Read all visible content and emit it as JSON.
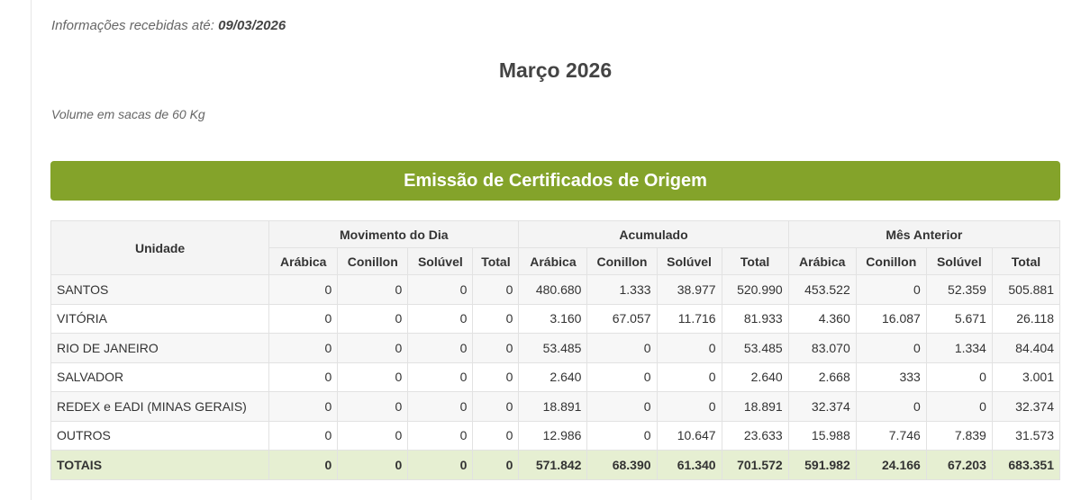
{
  "header": {
    "received_prefix": "Informações recebidas até:",
    "received_date": "09/03/2026",
    "title": "Março 2026",
    "volume_note": "Volume em sacas de 60 Kg"
  },
  "banner": {
    "title": "Emissão de Certificados de Origem",
    "color": "#84a32a"
  },
  "table": {
    "unit_header": "Unidade",
    "groups": [
      "Movimento do Dia",
      "Acumulado",
      "Mês Anterior"
    ],
    "subheaders": [
      "Arábica",
      "Conillon",
      "Solúvel",
      "Total"
    ],
    "rows": [
      {
        "unit": "SANTOS",
        "values": [
          "0",
          "0",
          "0",
          "0",
          "480.680",
          "1.333",
          "38.977",
          "520.990",
          "453.522",
          "0",
          "52.359",
          "505.881"
        ]
      },
      {
        "unit": "VITÓRIA",
        "values": [
          "0",
          "0",
          "0",
          "0",
          "3.160",
          "67.057",
          "11.716",
          "81.933",
          "4.360",
          "16.087",
          "5.671",
          "26.118"
        ]
      },
      {
        "unit": "RIO DE JANEIRO",
        "values": [
          "0",
          "0",
          "0",
          "0",
          "53.485",
          "0",
          "0",
          "53.485",
          "83.070",
          "0",
          "1.334",
          "84.404"
        ]
      },
      {
        "unit": "SALVADOR",
        "values": [
          "0",
          "0",
          "0",
          "0",
          "2.640",
          "0",
          "0",
          "2.640",
          "2.668",
          "333",
          "0",
          "3.001"
        ]
      },
      {
        "unit": "REDEX e EADI (MINAS GERAIS)",
        "values": [
          "0",
          "0",
          "0",
          "0",
          "18.891",
          "0",
          "0",
          "18.891",
          "32.374",
          "0",
          "0",
          "32.374"
        ]
      },
      {
        "unit": "OUTROS",
        "values": [
          "0",
          "0",
          "0",
          "0",
          "12.986",
          "0",
          "10.647",
          "23.633",
          "15.988",
          "7.746",
          "7.839",
          "31.573"
        ]
      }
    ],
    "totals": {
      "unit": "TOTAIS",
      "values": [
        "0",
        "0",
        "0",
        "0",
        "571.842",
        "68.390",
        "61.340",
        "701.572",
        "591.982",
        "24.166",
        "67.203",
        "683.351"
      ]
    }
  }
}
